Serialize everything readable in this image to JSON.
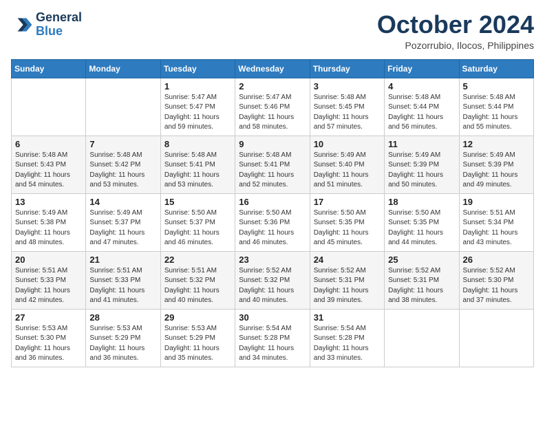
{
  "header": {
    "logo_line1": "General",
    "logo_line2": "Blue",
    "month": "October 2024",
    "location": "Pozorrubio, Ilocos, Philippines"
  },
  "weekdays": [
    "Sunday",
    "Monday",
    "Tuesday",
    "Wednesday",
    "Thursday",
    "Friday",
    "Saturday"
  ],
  "weeks": [
    [
      {
        "day": "",
        "info": ""
      },
      {
        "day": "",
        "info": ""
      },
      {
        "day": "1",
        "info": "Sunrise: 5:47 AM\nSunset: 5:47 PM\nDaylight: 11 hours\nand 59 minutes."
      },
      {
        "day": "2",
        "info": "Sunrise: 5:47 AM\nSunset: 5:46 PM\nDaylight: 11 hours\nand 58 minutes."
      },
      {
        "day": "3",
        "info": "Sunrise: 5:48 AM\nSunset: 5:45 PM\nDaylight: 11 hours\nand 57 minutes."
      },
      {
        "day": "4",
        "info": "Sunrise: 5:48 AM\nSunset: 5:44 PM\nDaylight: 11 hours\nand 56 minutes."
      },
      {
        "day": "5",
        "info": "Sunrise: 5:48 AM\nSunset: 5:44 PM\nDaylight: 11 hours\nand 55 minutes."
      }
    ],
    [
      {
        "day": "6",
        "info": "Sunrise: 5:48 AM\nSunset: 5:43 PM\nDaylight: 11 hours\nand 54 minutes."
      },
      {
        "day": "7",
        "info": "Sunrise: 5:48 AM\nSunset: 5:42 PM\nDaylight: 11 hours\nand 53 minutes."
      },
      {
        "day": "8",
        "info": "Sunrise: 5:48 AM\nSunset: 5:41 PM\nDaylight: 11 hours\nand 53 minutes."
      },
      {
        "day": "9",
        "info": "Sunrise: 5:48 AM\nSunset: 5:41 PM\nDaylight: 11 hours\nand 52 minutes."
      },
      {
        "day": "10",
        "info": "Sunrise: 5:49 AM\nSunset: 5:40 PM\nDaylight: 11 hours\nand 51 minutes."
      },
      {
        "day": "11",
        "info": "Sunrise: 5:49 AM\nSunset: 5:39 PM\nDaylight: 11 hours\nand 50 minutes."
      },
      {
        "day": "12",
        "info": "Sunrise: 5:49 AM\nSunset: 5:39 PM\nDaylight: 11 hours\nand 49 minutes."
      }
    ],
    [
      {
        "day": "13",
        "info": "Sunrise: 5:49 AM\nSunset: 5:38 PM\nDaylight: 11 hours\nand 48 minutes."
      },
      {
        "day": "14",
        "info": "Sunrise: 5:49 AM\nSunset: 5:37 PM\nDaylight: 11 hours\nand 47 minutes."
      },
      {
        "day": "15",
        "info": "Sunrise: 5:50 AM\nSunset: 5:37 PM\nDaylight: 11 hours\nand 46 minutes."
      },
      {
        "day": "16",
        "info": "Sunrise: 5:50 AM\nSunset: 5:36 PM\nDaylight: 11 hours\nand 46 minutes."
      },
      {
        "day": "17",
        "info": "Sunrise: 5:50 AM\nSunset: 5:35 PM\nDaylight: 11 hours\nand 45 minutes."
      },
      {
        "day": "18",
        "info": "Sunrise: 5:50 AM\nSunset: 5:35 PM\nDaylight: 11 hours\nand 44 minutes."
      },
      {
        "day": "19",
        "info": "Sunrise: 5:51 AM\nSunset: 5:34 PM\nDaylight: 11 hours\nand 43 minutes."
      }
    ],
    [
      {
        "day": "20",
        "info": "Sunrise: 5:51 AM\nSunset: 5:33 PM\nDaylight: 11 hours\nand 42 minutes."
      },
      {
        "day": "21",
        "info": "Sunrise: 5:51 AM\nSunset: 5:33 PM\nDaylight: 11 hours\nand 41 minutes."
      },
      {
        "day": "22",
        "info": "Sunrise: 5:51 AM\nSunset: 5:32 PM\nDaylight: 11 hours\nand 40 minutes."
      },
      {
        "day": "23",
        "info": "Sunrise: 5:52 AM\nSunset: 5:32 PM\nDaylight: 11 hours\nand 40 minutes."
      },
      {
        "day": "24",
        "info": "Sunrise: 5:52 AM\nSunset: 5:31 PM\nDaylight: 11 hours\nand 39 minutes."
      },
      {
        "day": "25",
        "info": "Sunrise: 5:52 AM\nSunset: 5:31 PM\nDaylight: 11 hours\nand 38 minutes."
      },
      {
        "day": "26",
        "info": "Sunrise: 5:52 AM\nSunset: 5:30 PM\nDaylight: 11 hours\nand 37 minutes."
      }
    ],
    [
      {
        "day": "27",
        "info": "Sunrise: 5:53 AM\nSunset: 5:30 PM\nDaylight: 11 hours\nand 36 minutes."
      },
      {
        "day": "28",
        "info": "Sunrise: 5:53 AM\nSunset: 5:29 PM\nDaylight: 11 hours\nand 36 minutes."
      },
      {
        "day": "29",
        "info": "Sunrise: 5:53 AM\nSunset: 5:29 PM\nDaylight: 11 hours\nand 35 minutes."
      },
      {
        "day": "30",
        "info": "Sunrise: 5:54 AM\nSunset: 5:28 PM\nDaylight: 11 hours\nand 34 minutes."
      },
      {
        "day": "31",
        "info": "Sunrise: 5:54 AM\nSunset: 5:28 PM\nDaylight: 11 hours\nand 33 minutes."
      },
      {
        "day": "",
        "info": ""
      },
      {
        "day": "",
        "info": ""
      }
    ]
  ]
}
